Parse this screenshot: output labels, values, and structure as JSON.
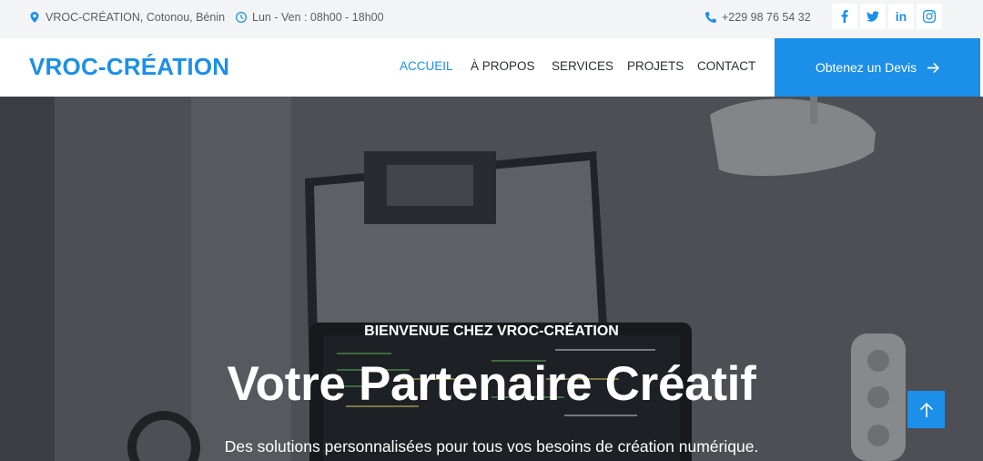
{
  "topbar": {
    "address": "VROC-CRÉATION, Cotonou, Bénin",
    "hours": "Lun - Ven : 08h00 - 18h00",
    "phone": "+229 98 76 54 32",
    "socials": [
      {
        "name": "facebook-icon"
      },
      {
        "name": "twitter-icon"
      },
      {
        "name": "linkedin-icon",
        "label": "in"
      },
      {
        "name": "instagram-icon"
      }
    ]
  },
  "navbar": {
    "logo": "VROC-CRÉATION",
    "links": [
      {
        "label": "ACCUEIL",
        "active": true
      },
      {
        "label": "À PROPOS",
        "active": false
      },
      {
        "label": "SERVICES",
        "active": false
      },
      {
        "label": "PROJETS",
        "active": false
      },
      {
        "label": "CONTACT",
        "active": false
      }
    ],
    "cta_label": "Obtenez un Devis"
  },
  "hero": {
    "eyebrow": "BIENVENUE CHEZ VROC-CRÉATION",
    "headline": "Votre Partenaire Créatif",
    "tagline": "Des solutions personnalisées pour tous vos besoins de création numérique."
  },
  "colors": {
    "accent": "#1c8fe8",
    "topbar_bg": "#f3f4f5",
    "text_dark": "#2b2e33"
  }
}
